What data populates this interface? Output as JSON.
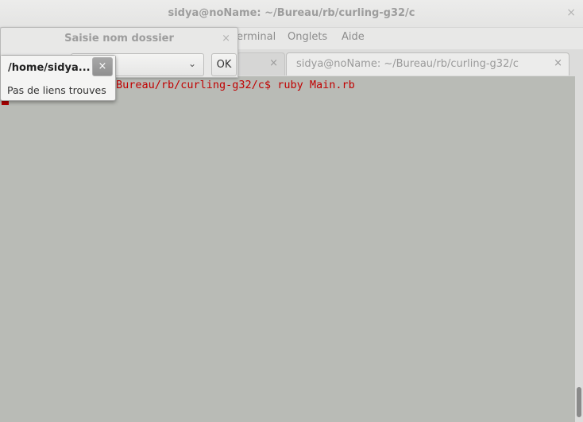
{
  "terminal": {
    "window_title": "sidya@noName: ~/Bureau/rb/curling-g32/c",
    "close_glyph": "×",
    "menus": [
      "erminal",
      "Onglets",
      "Aide"
    ],
    "tabs": [
      {
        "label": "",
        "close": "×"
      },
      {
        "label": "sidya@noName: ~/Bureau/rb/curling-g32/c",
        "close": "×"
      }
    ],
    "prompt_text": "Bureau/rb/curling-g32/c$ ruby Main.rb",
    "colors": {
      "background": "#b9bbb6",
      "text": "#c00000"
    }
  },
  "dialog": {
    "title": "Saisie nom dossier",
    "close_glyph": "×",
    "combo_value": "",
    "combo_arrow": "⌄",
    "ok_label": "OK"
  },
  "popover": {
    "path": "/home/sidya...",
    "close_glyph": "×",
    "message": "Pas de liens trouves"
  }
}
